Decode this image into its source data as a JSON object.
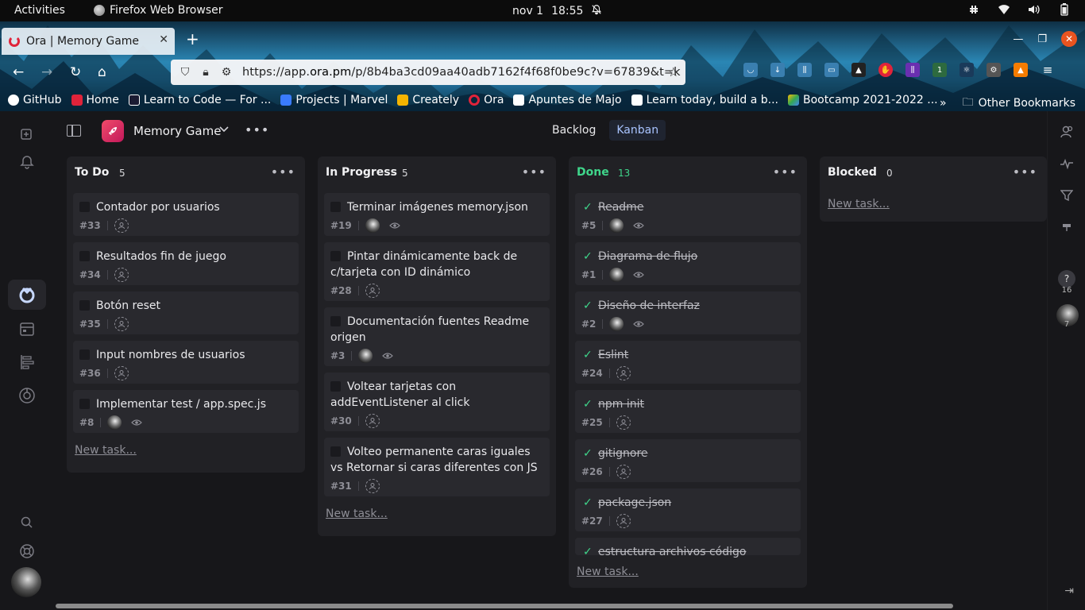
{
  "gnome": {
    "activities": "Activities",
    "app_name": "Firefox Web Browser",
    "date": "nov 1",
    "time": "18:55"
  },
  "browser": {
    "tab_title": "Ora | Memory Game",
    "url_prefix": "https://app.",
    "url_domain": "ora.pm",
    "url_suffix": "/p/8b4ba3cd09aa40adb7162f4f68f0be9c?v=67839&t=k",
    "ext_badge": "1",
    "bookmarks": [
      {
        "label": "GitHub",
        "color": "#ffffff"
      },
      {
        "label": "Home",
        "color": "#e0233a"
      },
      {
        "label": "Learn to Code — For ...",
        "color": "#1b1b32"
      },
      {
        "label": "Projects | Marvel",
        "color": "#3a7bfd"
      },
      {
        "label": "Creately",
        "color": "#f4b400"
      },
      {
        "label": "Ora",
        "color": "#e0233a"
      },
      {
        "label": "Apuntes de Majo",
        "color": "#ffffff"
      },
      {
        "label": "Learn today, build a b...",
        "color": "#ffffff"
      },
      {
        "label": "Bootcamp 2021-2022 ...",
        "color": "#34a853"
      }
    ],
    "other_bookmarks": "Other Bookmarks"
  },
  "app": {
    "project_name": "Memory Game",
    "views": [
      "Backlog",
      "Kanban"
    ],
    "active_view": "Kanban",
    "right_rail_counts": [
      "16",
      "7"
    ],
    "new_task_label": "New task..."
  },
  "columns": [
    {
      "title": "To Do",
      "count": "5",
      "cards": [
        {
          "title": "Contador por usuarios",
          "id": "#33",
          "assignee": "none",
          "watch": false
        },
        {
          "title": "Resultados fin de juego",
          "id": "#34",
          "assignee": "none",
          "watch": false
        },
        {
          "title": "Botón reset",
          "id": "#35",
          "assignee": "none",
          "watch": false
        },
        {
          "title": "Input nombres de usuarios",
          "id": "#36",
          "assignee": "none",
          "watch": false
        },
        {
          "title": "Implementar test / app.spec.js",
          "id": "#8",
          "assignee": "avatar",
          "watch": true
        }
      ]
    },
    {
      "title": "In Progress",
      "count": "5",
      "cards": [
        {
          "title": "Terminar imágenes memory.json",
          "id": "#19",
          "assignee": "avatar",
          "watch": true
        },
        {
          "title": "Pintar dinámicamente back de c/tarjeta con ID dinámico",
          "id": "#28",
          "assignee": "none",
          "watch": false
        },
        {
          "title": "Documentación fuentes Readme origen",
          "id": "#3",
          "assignee": "avatar",
          "watch": true
        },
        {
          "title": "Voltear tarjetas con addEventListener al click",
          "id": "#30",
          "assignee": "none",
          "watch": false
        },
        {
          "title": "Volteo permanente caras iguales vs Retornar si caras diferentes con JS",
          "id": "#31",
          "assignee": "none",
          "watch": false
        }
      ]
    },
    {
      "title": "Done",
      "count": "13",
      "accent": "#3fd68b",
      "cards": [
        {
          "title": "Readme",
          "id": "#5",
          "assignee": "avatar",
          "watch": true
        },
        {
          "title": "Diagrama de flujo",
          "id": "#1",
          "assignee": "avatar",
          "watch": true
        },
        {
          "title": "Diseño de interfaz",
          "id": "#2",
          "assignee": "avatar",
          "watch": true
        },
        {
          "title": "Eslint",
          "id": "#24",
          "assignee": "none",
          "watch": false
        },
        {
          "title": "npm init",
          "id": "#25",
          "assignee": "none",
          "watch": false
        },
        {
          "title": "gitignore",
          "id": "#26",
          "assignee": "none",
          "watch": false
        },
        {
          "title": "package.json",
          "id": "#27",
          "assignee": "none",
          "watch": false
        },
        {
          "title": "estructura archivos código",
          "id": "",
          "assignee": "none",
          "watch": false
        }
      ]
    },
    {
      "title": "Blocked",
      "count": "0",
      "cards": []
    }
  ]
}
